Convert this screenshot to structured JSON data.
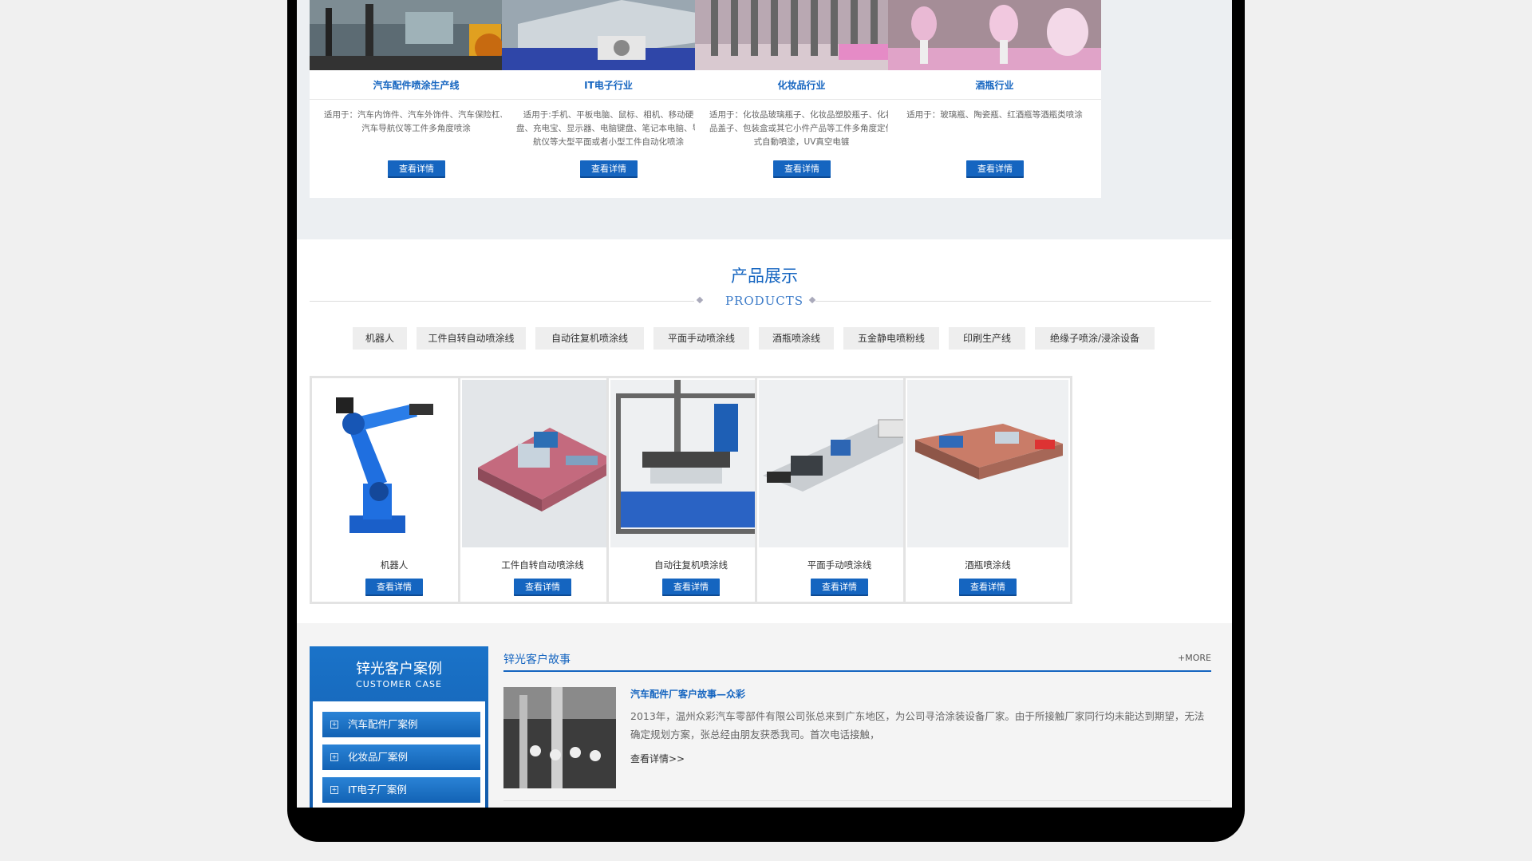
{
  "industries": [
    {
      "title": "汽车配件喷涂生产线",
      "desc": "适用于：汽车内饰件、汽车外饰件、汽车保险杠、汽车导航仪等工件多角度喷涂",
      "button": "查看详情"
    },
    {
      "title": "IT电子行业",
      "desc": "适用于:手机、平板电脑、鼠标、相机、移动硬盘、充电宝、显示器、电脑键盘、笔记本电脑、导航仪等大型平面或者小型工件自动化喷涂",
      "button": "查看详情"
    },
    {
      "title": "化妆品行业",
      "desc": "适用于：化妆品玻璃瓶子、化妆品塑胶瓶子、化妆品盖子、包装盒或其它小件产品等工件多角度定位式自動噴塗，UV真空电镀",
      "button": "查看详情"
    },
    {
      "title": "酒瓶行业",
      "desc": "适用于：玻璃瓶、陶瓷瓶、红酒瓶等酒瓶类喷涂",
      "button": "查看详情"
    }
  ],
  "products_section": {
    "title": "产品展示",
    "subtitle": "PRODUCTS",
    "tabs": [
      "机器人",
      "工件自转自动喷涂线",
      "自动往复机喷涂线",
      "平面手动喷涂线",
      "酒瓶喷涂线",
      "五金静电喷粉线",
      "印刷生产线",
      "绝缘子喷涂/浸涂设备"
    ],
    "items": [
      {
        "name": "机器人",
        "button": "查看详情"
      },
      {
        "name": "工件自转自动喷涂线",
        "button": "查看详情"
      },
      {
        "name": "自动往复机喷涂线",
        "button": "查看详情"
      },
      {
        "name": "平面手动喷涂线",
        "button": "查看详情"
      },
      {
        "name": "酒瓶喷涂线",
        "button": "查看详情"
      }
    ]
  },
  "customer_case": {
    "title": "锌光客户案例",
    "subtitle": "CUSTOMER CASE",
    "items": [
      "汽车配件厂案例",
      "化妆品厂案例",
      "IT电子厂案例"
    ]
  },
  "stories": {
    "title": "锌光客户故事",
    "more": "+MORE",
    "story_title": "汽车配件厂客户故事—众彩",
    "story_text": "2013年，温州众彩汽车零部件有限公司张总来到广东地区，为公司寻洽涂装设备厂家。由于所接触厂家同行均未能达到期望，无法确定规划方案，张总经由朋友获悉我司。首次电话接触，",
    "story_link": "查看详情>>"
  },
  "colors": {
    "accent": "#1565c0",
    "band": "#eceff2",
    "device": "#000000"
  }
}
